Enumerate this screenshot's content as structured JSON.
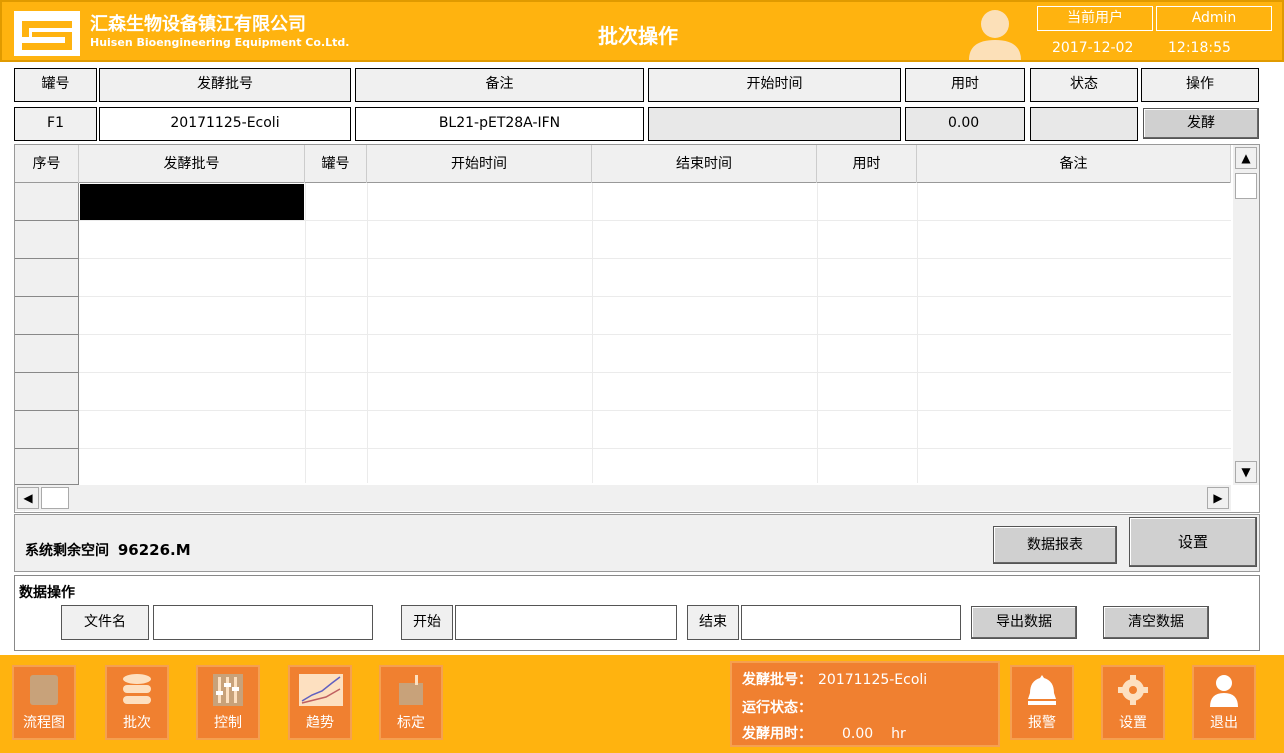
{
  "header": {
    "company_cn": "汇森生物设备镇江有限公司",
    "company_en": "Huisen Bioengineering Equipment Co.Ltd.",
    "page_title": "批次操作",
    "current_user_label": "当前用户",
    "user_name": "Admin",
    "date": "2017-12-02",
    "time": "12:18:55"
  },
  "batch_header": {
    "columns": [
      "罐号",
      "发酵批号",
      "备注",
      "开始时间",
      "用时",
      "状态",
      "操作"
    ]
  },
  "batch_row": {
    "tank": "F1",
    "batch_no": "20171125-Ecoli",
    "remark": "BL21-pET28A-IFN",
    "start_time": "",
    "elapsed": "0.00",
    "status": "",
    "action_button": "发酵"
  },
  "table": {
    "columns": [
      "序号",
      "发酵批号",
      "罐号",
      "开始时间",
      "结束时间",
      "用时",
      "备注"
    ],
    "rows": []
  },
  "disk": {
    "label": "系统剩余空间",
    "value": "96226.M"
  },
  "buttons": {
    "report": "数据报表",
    "settings": "设置",
    "export": "导出数据",
    "clear": "清空数据"
  },
  "data_ops": {
    "title": "数据操作",
    "filename_label": "文件名",
    "filename_value": "",
    "start_label": "开始",
    "start_value": "",
    "end_label": "结束",
    "end_value": ""
  },
  "nav": {
    "flow": "流程图",
    "batch": "批次",
    "control": "控制",
    "trend": "趋势",
    "calibrate": "标定",
    "alarm": "报警",
    "settings": "设置",
    "exit": "退出"
  },
  "status_panel": {
    "batch_label": "发酵批号：",
    "batch_value": "20171125-Ecoli",
    "run_label": "运行状态：",
    "run_value": "",
    "time_label": "发酵用时：",
    "time_value": "0.00",
    "time_unit": "hr"
  },
  "colors": {
    "header_bg": "#ffb30f",
    "nav_bg": "#f08030"
  }
}
